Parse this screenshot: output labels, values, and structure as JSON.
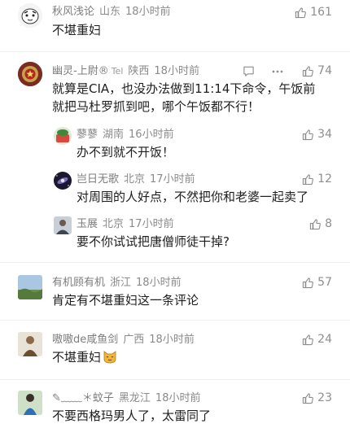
{
  "comments": [
    {
      "name": "秋风浅论",
      "region": "山东",
      "time": "18小时前",
      "text": "不堪重妇",
      "likes": "161"
    },
    {
      "name": "幽灵-上尉®",
      "badge": "Tel",
      "region": "陕西",
      "time": "18小时前",
      "text": "就算是CIA，也没办法做到11:14下命令，午饭前就把马杜罗抓到吧，哪个午饭都不行！",
      "likes": "74"
    },
    {
      "name": "蓼蓼",
      "region": "湖南",
      "time": "16小时前",
      "text": "办不到就不开饭！",
      "likes": "34"
    },
    {
      "name": "岂日无歌",
      "region": "北京",
      "time": "17小时前",
      "text": "对周围的人好点，不然把你和老婆一起卖了",
      "likes": "12"
    },
    {
      "name": "玉展",
      "region": "北京",
      "time": "17小时前",
      "text": "要不你试试把唐僧师徒干掉?",
      "likes": "8"
    },
    {
      "name": "有机顾有机",
      "region": "浙江",
      "time": "18小时前",
      "text": "肯定有不堪重妇这一条评论",
      "likes": "57"
    },
    {
      "name": "嗷嗷de咸鱼剑",
      "region": "广西",
      "time": "18小时前",
      "text": "不堪重妇",
      "likes": "24"
    },
    {
      "name": "✎﹏﹏＊蚊子",
      "region": "黑龙江",
      "time": "18小时前",
      "text": "不要西格玛男人了，太雷同了",
      "likes": "23"
    }
  ],
  "colors": {
    "meta": "#8a8a8a",
    "text": "#1e1e1e",
    "like": "#8e8e8e"
  },
  "icons": [
    "thumbs-up-icon",
    "comment-icon",
    "more-icon",
    "cat-emoji"
  ]
}
